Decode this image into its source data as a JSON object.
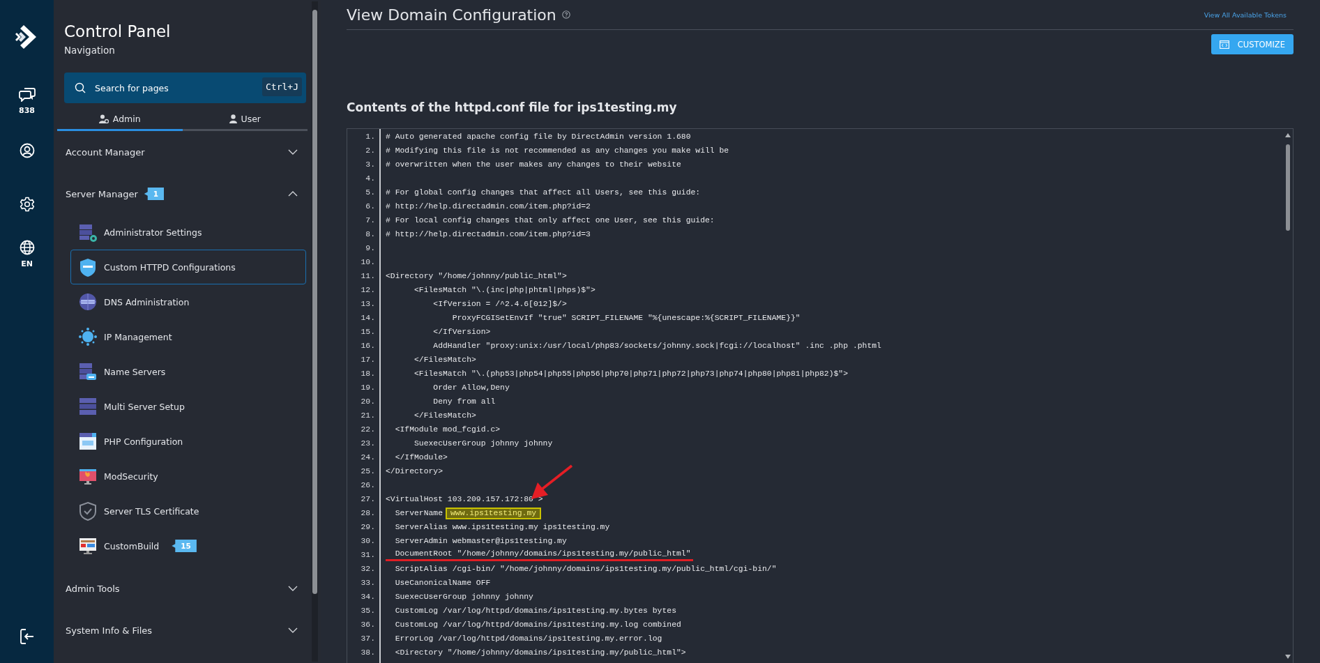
{
  "rail": {
    "messages_count": "838",
    "language": "EN"
  },
  "sidebar": {
    "title": "Control Panel",
    "subtitle": "Navigation",
    "search": {
      "placeholder": "Search for pages",
      "shortcut": "Ctrl+J"
    },
    "tabs": [
      {
        "label": "Admin",
        "selected": true
      },
      {
        "label": "User",
        "selected": false
      }
    ],
    "sections": [
      {
        "label": "Account Manager",
        "expanded": false
      },
      {
        "label": "Server Manager",
        "badge": "1",
        "expanded": true,
        "items": [
          {
            "label": "Administrator Settings",
            "selected": false
          },
          {
            "label": "Custom HTTPD Configurations",
            "selected": true
          },
          {
            "label": "DNS Administration",
            "selected": false
          },
          {
            "label": "IP Management",
            "selected": false
          },
          {
            "label": "Name Servers",
            "selected": false
          },
          {
            "label": "Multi Server Setup",
            "selected": false
          },
          {
            "label": "PHP Configuration",
            "selected": false
          },
          {
            "label": "ModSecurity",
            "selected": false
          },
          {
            "label": "Server TLS Certificate",
            "selected": false
          },
          {
            "label": "CustomBuild",
            "selected": false,
            "badge": "15"
          }
        ]
      },
      {
        "label": "Admin Tools",
        "expanded": false
      },
      {
        "label": "System Info & Files",
        "expanded": false
      }
    ]
  },
  "header": {
    "title": "View Domain Configuration",
    "link": "View All Available Tokens",
    "button": "CUSTOMIZE"
  },
  "file_heading": "Contents of the httpd.conf file for ips1testing.my",
  "code": {
    "lines": [
      {
        "number": "1.",
        "text": "# Auto generated apache config file by DirectAdmin version 1.680"
      },
      {
        "number": "2.",
        "text": "# Modifying this file is not recommended as any changes you make will be"
      },
      {
        "number": "3.",
        "text": "# overwritten when the user makes any changes to their website"
      },
      {
        "number": "4."
      },
      {
        "number": "5.",
        "text": "# For global config changes that affect all Users, see this guide:"
      },
      {
        "number": "6.",
        "text": "# http://help.directadmin.com/item.php?id=2"
      },
      {
        "number": "7.",
        "text": "# For local config changes that only affect one User, see this guide:"
      },
      {
        "number": "8.",
        "text": "# http://help.directadmin.com/item.php?id=3"
      },
      {
        "number": "9."
      },
      {
        "number": "10."
      },
      {
        "number": "11.",
        "text": "<Directory \"/home/johnny/public_html\">"
      },
      {
        "number": "12.",
        "text": "      <FilesMatch \"\\.(inc|php|phtml|phps)$\">"
      },
      {
        "number": "13.",
        "text": "          <IfVersion = /^2.4.6[012]$/>"
      },
      {
        "number": "14.",
        "text": "              ProxyFCGISetEnvIf \"true\" SCRIPT_FILENAME \"%{unescape:%{SCRIPT_FILENAME}}\""
      },
      {
        "number": "15.",
        "text": "          </IfVersion>"
      },
      {
        "number": "16.",
        "text": "          AddHandler \"proxy:unix:/usr/local/php83/sockets/johnny.sock|fcgi://localhost\" .inc .php .phtml"
      },
      {
        "number": "17.",
        "text": "      </FilesMatch>"
      },
      {
        "number": "18.",
        "text": "      <FilesMatch \"\\.(php53|php54|php55|php56|php70|php71|php72|php73|php74|php80|php81|php82)$\">"
      },
      {
        "number": "19.",
        "text": "          Order Allow,Deny"
      },
      {
        "number": "20.",
        "text": "          Deny from all"
      },
      {
        "number": "21.",
        "text": "      </FilesMatch>"
      },
      {
        "number": "22.",
        "text": "  <IfModule mod_fcgid.c>"
      },
      {
        "number": "23.",
        "text": "      SuexecUserGroup johnny johnny"
      },
      {
        "number": "24.",
        "text": "  </IfModule>"
      },
      {
        "number": "25.",
        "text": "</Directory>"
      },
      {
        "number": "26."
      },
      {
        "number": "27.",
        "text": "<VirtualHost 103.209.157.172:80 >",
        "arrow": true
      },
      {
        "number": "28.",
        "text": "  ServerName",
        "highlight": "www.ips1testing.my"
      },
      {
        "number": "29.",
        "text": "  ServerAlias www.ips1testing.my ips1testing.my"
      },
      {
        "number": "30.",
        "text": "  ServerAdmin webmaster@ips1testing.my"
      },
      {
        "number": "31.",
        "text": "  DocumentRoot \"/home/johnny/domains/ips1testing.my/public_html\"",
        "underline": true
      },
      {
        "number": "32.",
        "text": "  ScriptAlias /cgi-bin/ \"/home/johnny/domains/ips1testing.my/public_html/cgi-bin/\""
      },
      {
        "number": "33.",
        "text": "  UseCanonicalName OFF"
      },
      {
        "number": "34.",
        "text": "  SuexecUserGroup johnny johnny"
      },
      {
        "number": "35.",
        "text": "  CustomLog /var/log/httpd/domains/ips1testing.my.bytes bytes"
      },
      {
        "number": "36.",
        "text": "  CustomLog /var/log/httpd/domains/ips1testing.my.log combined"
      },
      {
        "number": "37.",
        "text": "  ErrorLog /var/log/httpd/domains/ips1testing.my.error.log"
      },
      {
        "number": "38.",
        "text": "  <Directory \"/home/johnny/domains/ips1testing.my/public_html\">"
      }
    ]
  }
}
